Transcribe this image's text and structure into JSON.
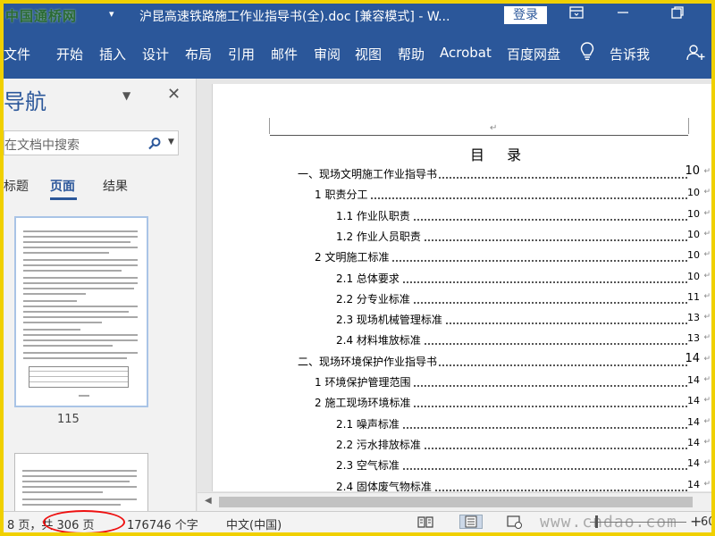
{
  "titlebar": {
    "watermark": "中国通桥网",
    "doc_title": "沪昆高速铁路施工作业指导书(全).doc [兼容模式] - W...",
    "login_label": "登录"
  },
  "ribbon": {
    "tabs": [
      "文件",
      "开始",
      "插入",
      "设计",
      "布局",
      "引用",
      "邮件",
      "审阅",
      "视图",
      "帮助",
      "Acrobat",
      "百度网盘"
    ],
    "tell_me": "告诉我"
  },
  "nav": {
    "title": "导航",
    "search_placeholder": "在文档中搜索",
    "tabs": [
      "标题",
      "页面",
      "结果"
    ],
    "thumb_page": "115"
  },
  "doc": {
    "toc_title": "目 录",
    "paragraph_mark": "↵",
    "toc": [
      {
        "text": "一、现场文明施工作业指导书",
        "page": "10",
        "level": 1
      },
      {
        "text": "1 职责分工",
        "page": "10",
        "level": 2
      },
      {
        "text": "1.1 作业队职责",
        "page": "10",
        "level": 3
      },
      {
        "text": "1.2 作业人员职责",
        "page": "10",
        "level": 3
      },
      {
        "text": "2 文明施工标准",
        "page": "10",
        "level": 2
      },
      {
        "text": "2.1 总体要求",
        "page": "10",
        "level": 3
      },
      {
        "text": "2.2 分专业标准",
        "page": "11",
        "level": 3
      },
      {
        "text": "2.3 现场机械管理标准",
        "page": "13",
        "level": 3
      },
      {
        "text": "2.4 材料堆放标准",
        "page": "13",
        "level": 3
      },
      {
        "text": "二、现场环境保护作业指导书",
        "page": "14",
        "level": 1
      },
      {
        "text": "1 环境保护管理范围",
        "page": "14",
        "level": 2
      },
      {
        "text": "2 施工现场环境标准",
        "page": "14",
        "level": 2
      },
      {
        "text": "2.1 噪声标准",
        "page": "14",
        "level": 3
      },
      {
        "text": "2.2 污水排放标准",
        "page": "14",
        "level": 3
      },
      {
        "text": "2.3 空气标准",
        "page": "14",
        "level": 3
      },
      {
        "text": "2.4 固体废气物标准",
        "page": "14",
        "level": 3
      }
    ]
  },
  "statusbar": {
    "page_info": "8 页，共 306 页",
    "word_count": "176746 个字",
    "language": "中文(中国)",
    "watermark": "www.cndao.com",
    "zoom": "60"
  }
}
